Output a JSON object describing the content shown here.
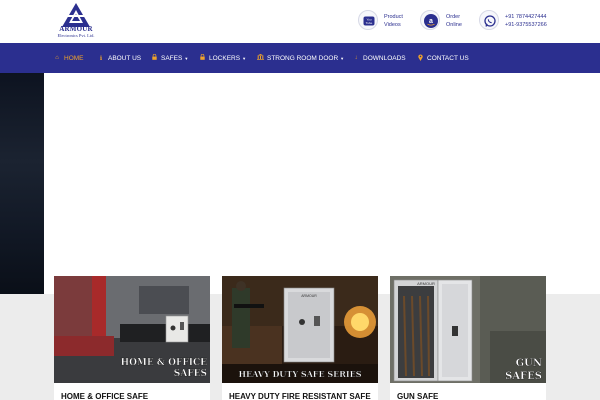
{
  "brand": {
    "name": "ARMOUR",
    "subtitle": "Electronics Pvt. Ltd."
  },
  "header_links": {
    "product_videos": {
      "line1": "Product",
      "line2": "Videos",
      "icon": "youtube-icon"
    },
    "order_online": {
      "line1": "Order",
      "line2": "Online",
      "icon": "amazon-icon"
    },
    "phones": {
      "line1": "+91 7874427444",
      "line2": "+91-9375537266",
      "icon": "whatsapp-icon"
    }
  },
  "nav": {
    "items": [
      {
        "label": "HOME",
        "icon": "home-icon",
        "active": true
      },
      {
        "label": "ABOUT US",
        "icon": "info-icon"
      },
      {
        "label": "SAFES",
        "icon": "lock-icon",
        "dropdown": true
      },
      {
        "label": "LOCKERS",
        "icon": "lock-icon",
        "dropdown": true
      },
      {
        "label": "STRONG ROOM DOOR",
        "icon": "bank-icon",
        "dropdown": true
      },
      {
        "label": "DOWNLOADS",
        "icon": "download-icon"
      },
      {
        "label": "CONTACT US",
        "icon": "map-marker-icon"
      }
    ]
  },
  "products": [
    {
      "title": "HOME & OFFICE SAFE",
      "overlay_line1": "HOME & OFFICE",
      "overlay_line2": "SAFES"
    },
    {
      "title": "HEAVY DUTY FIRE RESISTANT SAFE",
      "overlay_line1": "HEAVY DUTY SAFE SERIES",
      "cabinet_label": "ARMOUR"
    },
    {
      "title": "GUN SAFE",
      "overlay_line1": "GUN",
      "overlay_line2": "SAFES",
      "cabinet_label": "ARMOUR"
    }
  ],
  "colors": {
    "brand_blue": "#2b2f8f",
    "accent_orange": "#f0a32a"
  }
}
